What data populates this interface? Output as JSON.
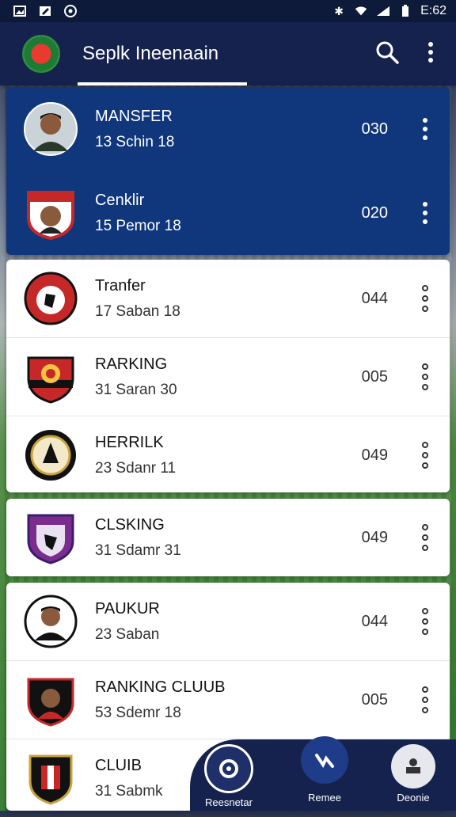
{
  "status_bar": {
    "left_icons": [
      "image-icon",
      "edit-icon",
      "settings-icon"
    ],
    "right_icons": [
      "bluetooth-icon",
      "wifi-icon",
      "signal-icon",
      "battery-icon"
    ],
    "time": "E:62"
  },
  "app_bar": {
    "title": "Seplk Ineenaain",
    "search_icon": "search-icon",
    "menu_icon": "more-vertical-icon"
  },
  "colors": {
    "app_bar": "#15224e",
    "highlight_card": "#10367c",
    "card": "#ffffff"
  },
  "highlighted": [
    {
      "title": "MANSFER",
      "subtitle": "13 Schin 18",
      "count": "030"
    },
    {
      "title": "Cenklir",
      "subtitle": "15 Pemor 18",
      "count": "020"
    }
  ],
  "group_a": [
    {
      "title": "Tranfer",
      "subtitle": "17 Saban 18",
      "count": "044"
    },
    {
      "title": "RARKING",
      "subtitle": "31 Saran 30",
      "count": "005"
    },
    {
      "title": "HERRILK",
      "subtitle": "23 Sdanr 11",
      "count": "049"
    }
  ],
  "group_b": [
    {
      "title": "CLSKING",
      "subtitle": "31 Sdamr 31",
      "count": "049"
    }
  ],
  "group_c": [
    {
      "title": "PAUKUR",
      "subtitle": "23 Saban",
      "count": "044"
    },
    {
      "title": "RANKING CLUUB",
      "subtitle": "53 Sdemr 18",
      "count": "005"
    },
    {
      "title": "CLUIB",
      "subtitle": "31 Sabmk",
      "count": ""
    }
  ],
  "bottom_nav": [
    {
      "label": "Reesnetar",
      "icon": "home-icon"
    },
    {
      "label": "Remee",
      "icon": "ball-icon"
    },
    {
      "label": "Deonie",
      "icon": "profile-icon"
    }
  ]
}
